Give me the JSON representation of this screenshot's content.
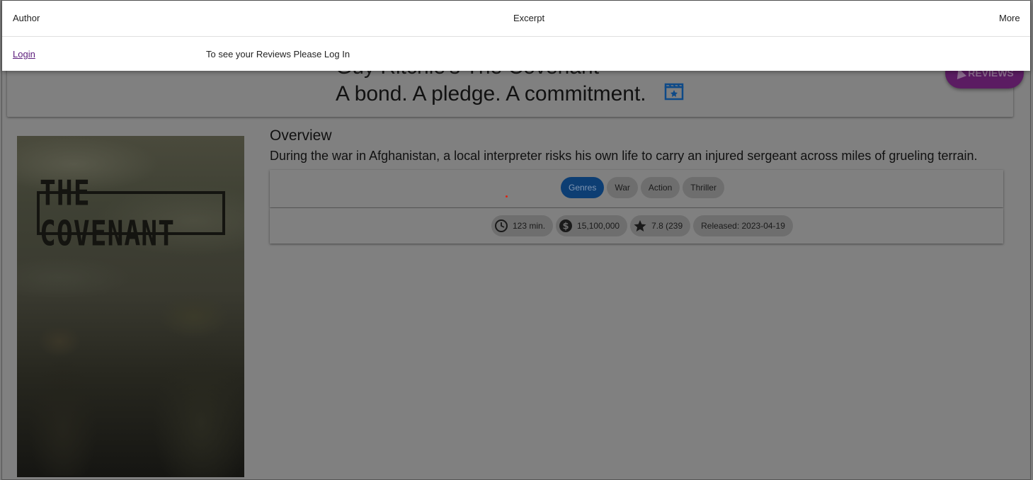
{
  "header": {
    "author_label": "Author",
    "excerpt_label": "Excerpt",
    "more_label": "More",
    "login_label": "Login",
    "reviews_prompt": "To see your Reviews Please Log In"
  },
  "movie": {
    "title_line": "Guy Ritchie's The Covenant",
    "tagline": "A bond. A pledge. A commitment.",
    "reviews_button": "REVIEWS",
    "poster_title": "THE COVENANT",
    "overview_heading": "Overview",
    "overview_text": "During the war in Afghanistan, a local interpreter risks his own life to carry an injured sergeant across miles of grueling terrain.",
    "genres_label": "Genres",
    "genres": [
      "War",
      "Action",
      "Thriller"
    ],
    "runtime": "123 min.",
    "budget": "15,100,000",
    "rating": "7.8 (239",
    "released": "Released: 2023-04-19"
  },
  "icons": {
    "movie": "movie-clapper-icon",
    "clock": "clock-icon",
    "money": "dollar-icon",
    "star": "star-icon",
    "navigate": "navigation-arrow-icon"
  },
  "colors": {
    "primary": "#1565c0",
    "accent": "#7b1fa2",
    "overlay": "#808080"
  }
}
